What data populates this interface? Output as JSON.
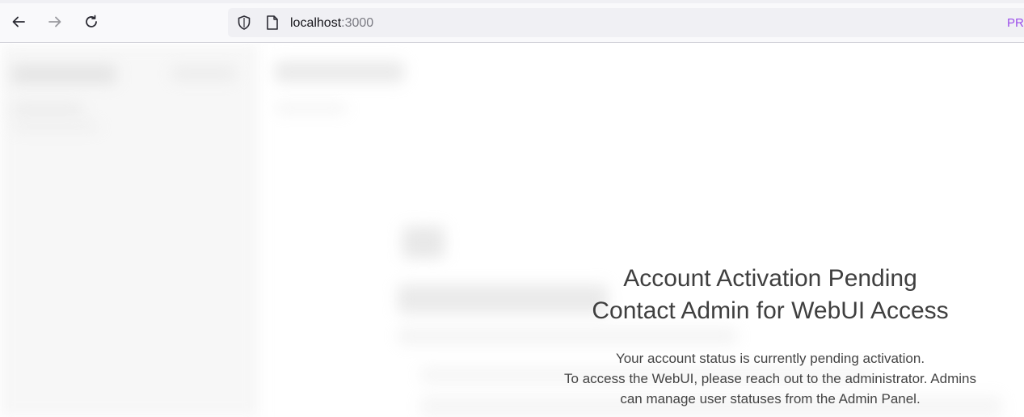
{
  "browser": {
    "url_host": "localhost",
    "url_port": ":3000",
    "toolbar_right_label": "PR",
    "icons": [
      "back-arrow-icon",
      "forward-arrow-icon",
      "reload-icon",
      "shield-icon",
      "page-icon"
    ]
  },
  "overlay": {
    "title_line1": "Account Activation Pending",
    "title_line2": "Contact Admin for WebUI Access",
    "desc_line1": "Your account status is currently pending activation.",
    "desc_line2": "To access the WebUI, please reach out to the administrator. Admins",
    "desc_line3": "can manage user statuses from the Admin Panel."
  },
  "colors": {
    "text": "#444444",
    "private_accent": "#9b4dea"
  }
}
